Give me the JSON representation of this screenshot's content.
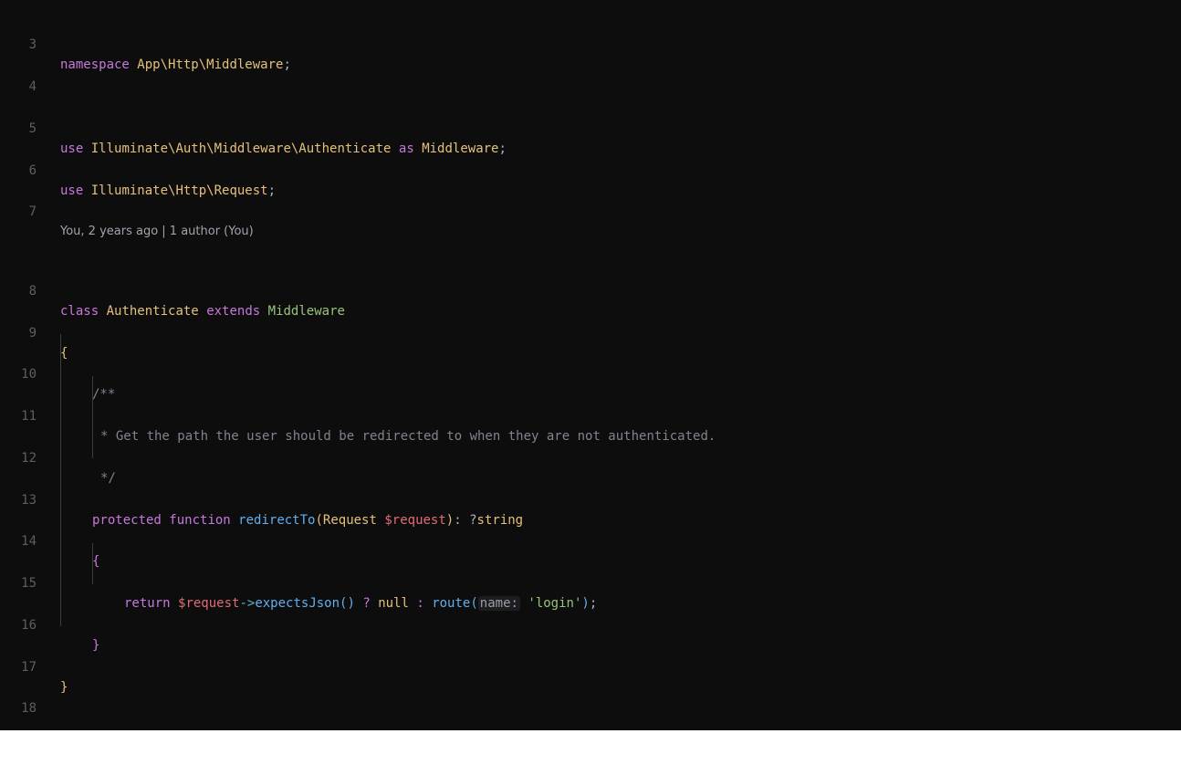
{
  "editor": {
    "codelens": "You, 2 years ago | 1 author (You)",
    "lines": {
      "l3": {
        "number": "3",
        "t1": "namespace",
        "t2": " ",
        "t3": "App\\Http\\Middleware",
        "t4": ";"
      },
      "l4": {
        "number": "4"
      },
      "l5": {
        "number": "5",
        "t1": "use",
        "t2": " ",
        "t3": "Illuminate\\Auth\\Middleware\\Authenticate",
        "t4": " ",
        "t5": "as",
        "t6": " ",
        "t7": "Middleware",
        "t8": ";"
      },
      "l6": {
        "number": "6",
        "t1": "use",
        "t2": " ",
        "t3": "Illuminate\\Http\\Request",
        "t4": ";"
      },
      "l7": {
        "number": "7"
      },
      "l8": {
        "number": "8",
        "t1": "class",
        "t2": " ",
        "t3": "Authenticate",
        "t4": " ",
        "t5": "extends",
        "t6": " ",
        "t7": "Middleware"
      },
      "l9": {
        "number": "9",
        "t1": "{"
      },
      "l10": {
        "number": "10",
        "t1": "/**"
      },
      "l11": {
        "number": "11",
        "t1": "* Get the path the user should be redirected to when they are not authenticated."
      },
      "l12": {
        "number": "12",
        "t1": "*/"
      },
      "l13": {
        "number": "13",
        "t1": "protected",
        "t2": " ",
        "t3": "function",
        "t4": " ",
        "t5": "redirectTo",
        "t6": "(",
        "t7": "Request",
        "t8": " ",
        "t9": "$request",
        "t10": ")",
        "t11": ": ?",
        "t12": "string"
      },
      "l14": {
        "number": "14",
        "t1": "{"
      },
      "l15": {
        "number": "15",
        "t1": "return",
        "t2": " ",
        "t3": "$request",
        "t4": "->",
        "t5": "expectsJson",
        "t6": "()",
        "t7": " ? ",
        "t8": "null",
        "t9": " : ",
        "t10": "route",
        "t11": "(",
        "t12": "name:",
        "t13": " ",
        "t14": "'login'",
        "t15": ")",
        "t16": ";"
      },
      "l16": {
        "number": "16",
        "t1": "}"
      },
      "l17": {
        "number": "17",
        "t1": "}"
      },
      "l18": {
        "number": "18"
      }
    }
  }
}
